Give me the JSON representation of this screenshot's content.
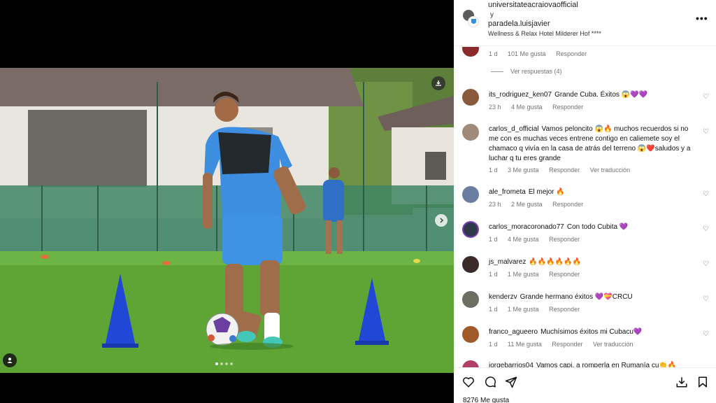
{
  "post": {
    "author": "universitateacraiova",
    "author_suffix": "official",
    "connector": "y",
    "coauthor": "paradela.luisjavier",
    "location": "Wellness & Relax Hotel Milderer Hof ****",
    "more_icon": "more-horizontal-icon",
    "likes": "8276 Me gusta"
  },
  "first_meta": {
    "time": "1 d",
    "likes": "101 Me gusta",
    "reply": "Responder"
  },
  "view_replies": "Ver respuestas (4)",
  "comments": [
    {
      "user": "its_rodriguez_ken07",
      "text": "Grande Cuba. Éxitos 😱💜💜",
      "time": "23 h",
      "likes": "4 Me gusta",
      "reply": "Responder",
      "translate": ""
    },
    {
      "user": "carlos_d_official",
      "text": "Vamos peloncito 😱🔥 muchos recuerdos si no me con es muchas veces entrene contigo en caliemete soy el chamaco q vivía en la casa de atrás del terreno 😱❤️saludos y a luchar q tu eres grande",
      "time": "1 d",
      "likes": "3 Me gusta",
      "reply": "Responder",
      "translate": "Ver traducción"
    },
    {
      "user": "ale_frometa",
      "text": "El mejor 🔥",
      "time": "23 h",
      "likes": "2 Me gusta",
      "reply": "Responder",
      "translate": ""
    },
    {
      "user": "carlos_moracoronado77",
      "text": "Con todo Cubita 💜",
      "time": "1 d",
      "likes": "4 Me gusta",
      "reply": "Responder",
      "translate": ""
    },
    {
      "user": "js_malvarez",
      "text": "🔥🔥🔥🔥🔥🔥",
      "time": "1 d",
      "likes": "1 Me gusta",
      "reply": "Responder",
      "translate": ""
    },
    {
      "user": "kenderzv",
      "text": "Grande hermano éxitos 💜💝CRCU",
      "time": "1 d",
      "likes": "1 Me gusta",
      "reply": "Responder",
      "translate": ""
    },
    {
      "user": "franco_agueero",
      "text": "Muchísimos éxitos mi Cubacu💜",
      "time": "1 d",
      "likes": "11 Me gusta",
      "reply": "Responder",
      "translate": "Ver traducción"
    },
    {
      "user": "jorgebarrios04",
      "text": "Vamos capi, a romperla en Rumanía cu👏🔥",
      "time": "",
      "likes": "",
      "reply": "",
      "translate": ""
    }
  ],
  "colors": {
    "text": "#111111",
    "meta": "#737373",
    "avatar_ring": "#7d3fb5"
  }
}
